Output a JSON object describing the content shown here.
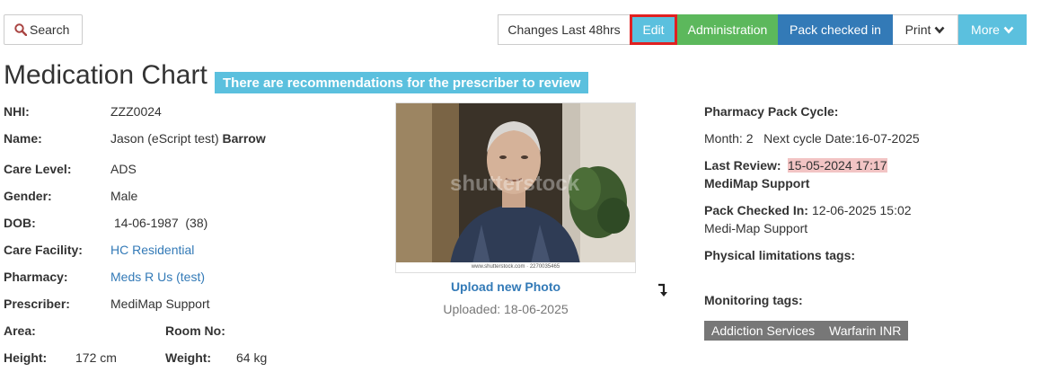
{
  "toolbar": {
    "search_label": "Search",
    "changes_label": "Changes Last 48hrs",
    "edit_label": "Edit",
    "admin_label": "Administration",
    "pack_label": "Pack checked in",
    "print_label": "Print",
    "more_label": "More"
  },
  "page": {
    "title": "Medication Chart",
    "banner": "There are recommendations for the prescriber to review"
  },
  "patient": {
    "nhi_label": "NHI:",
    "nhi": "ZZZ0024",
    "name_label": "Name:",
    "name_first": "Jason (eScript test)",
    "name_last": "Barrow",
    "care_level_label": "Care Level:",
    "care_level": "ADS",
    "gender_label": "Gender:",
    "gender": "Male",
    "dob_label": "DOB:",
    "dob": "14-06-1987  (38)",
    "facility_label": "Care Facility:",
    "facility": "HC Residential",
    "pharmacy_label": "Pharmacy:",
    "pharmacy": "Meds R Us (test)",
    "prescriber_label": "Prescriber:",
    "prescriber": "MediMap Support",
    "area_label": "Area:",
    "room_label": "Room No:",
    "height_label": "Height:",
    "height": "172 cm",
    "weight_label": "Weight:",
    "weight": "64 kg"
  },
  "photo": {
    "watermark": "shutterstock",
    "strip_text": "www.shutterstock.com · 2270035465",
    "upload_label": "Upload new Photo",
    "uploaded": "Uploaded: 18-06-2025"
  },
  "pharmacy_info": {
    "cycle_label": "Pharmacy Pack Cycle:",
    "cycle_value": "Month: 2   Next cycle Date:16-07-2025",
    "review_label": "Last Review:",
    "review_date": "15-05-2024 17:17",
    "review_by": "MediMap Support",
    "checked_label": "Pack Checked In:",
    "checked_date": "12-06-2025 15:02",
    "checked_by": "Medi-Map Support",
    "physical_label": "Physical limitations tags:",
    "monitoring_label": "Monitoring tags:",
    "tags": [
      "Addiction Services",
      "Warfarin INR"
    ]
  }
}
